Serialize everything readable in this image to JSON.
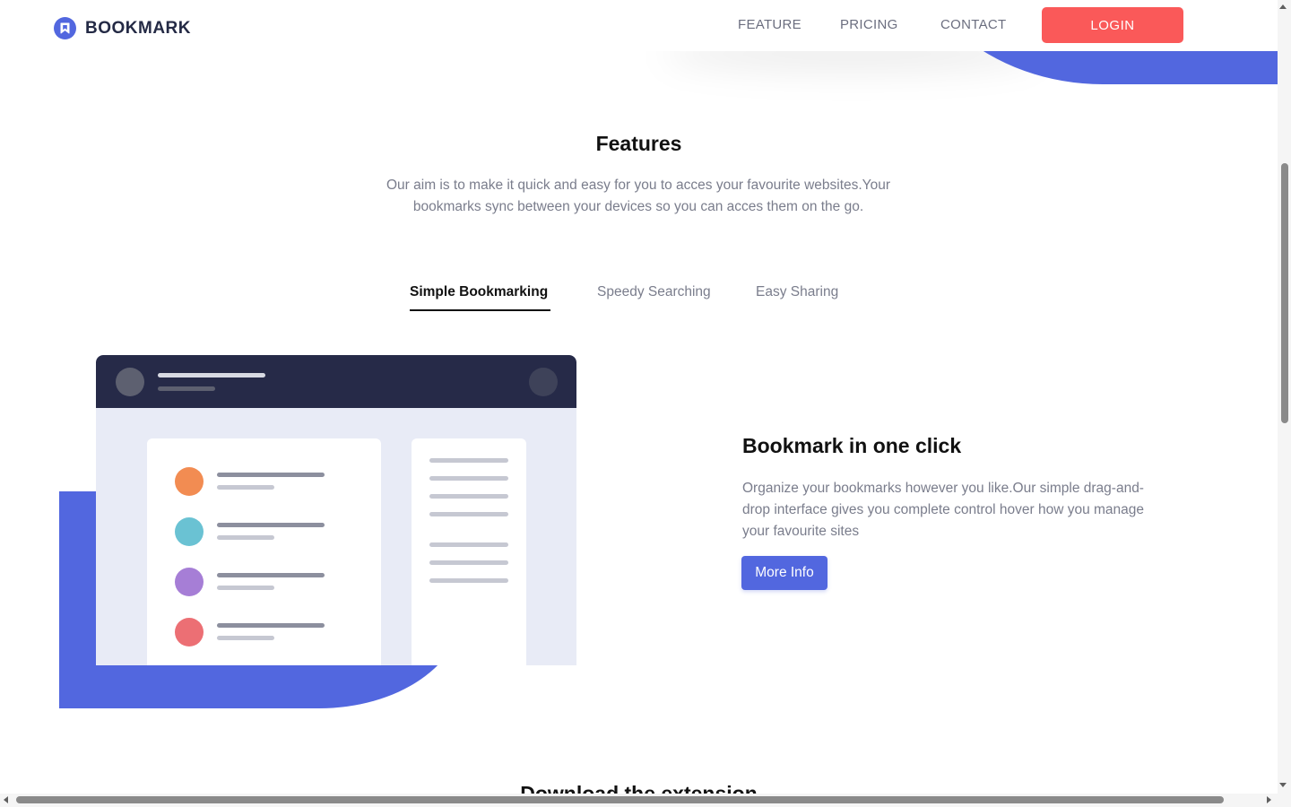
{
  "header": {
    "brand": "BOOKMARK",
    "logo_icon": "bookmark-icon",
    "nav": [
      {
        "label": "FEATURE"
      },
      {
        "label": "PRICING"
      },
      {
        "label": "CONTACT"
      }
    ],
    "login_label": "LOGIN"
  },
  "features": {
    "title": "Features",
    "description": "Our aim is to make it quick and easy for you to acces your favourite websites.Your bookmarks sync between your devices so you can acces them on the go.",
    "tabs": [
      {
        "label": "Simple Bookmarking",
        "active": true
      },
      {
        "label": "Speedy Searching",
        "active": false
      },
      {
        "label": "Easy Sharing",
        "active": false
      }
    ],
    "panel": {
      "title": "Bookmark in one click",
      "description": "Organize your bookmarks however you like.Our simple drag-and-drop interface gives you complete control hover how you manage your favourite sites",
      "button_label": "More Info"
    }
  },
  "next_section": {
    "title_partial": "Download the extension"
  },
  "colors": {
    "accent_blue": "#5267df",
    "accent_red": "#fa5959",
    "dark_navy": "#242a45",
    "mock_dots": [
      "#f28c52",
      "#6ac2d3",
      "#a67ed6",
      "#ec6f74"
    ]
  }
}
